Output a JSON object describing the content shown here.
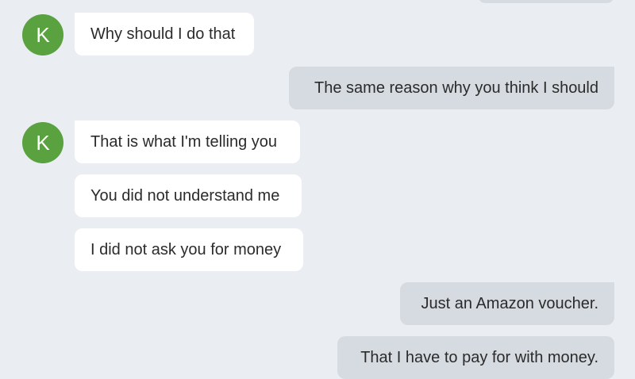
{
  "conversation": {
    "messages": [
      {
        "direction": "in",
        "text": "Why should I do that",
        "avatar_letter": "K"
      },
      {
        "direction": "out",
        "text": "The same reason why you think I should"
      },
      {
        "direction": "in",
        "text": "That is what I'm telling you",
        "avatar_letter": "K"
      },
      {
        "direction": "in",
        "text": "You did not understand me"
      },
      {
        "direction": "in",
        "text": "I did not ask you for money"
      },
      {
        "direction": "out",
        "text": "Just an Amazon voucher."
      },
      {
        "direction": "out",
        "text": "That I have to pay for with money."
      }
    ]
  },
  "colors": {
    "background": "#eaedf1",
    "incoming_bubble": "#ffffff",
    "outgoing_bubble": "#d5dbe1",
    "avatar": "#5aa140"
  }
}
